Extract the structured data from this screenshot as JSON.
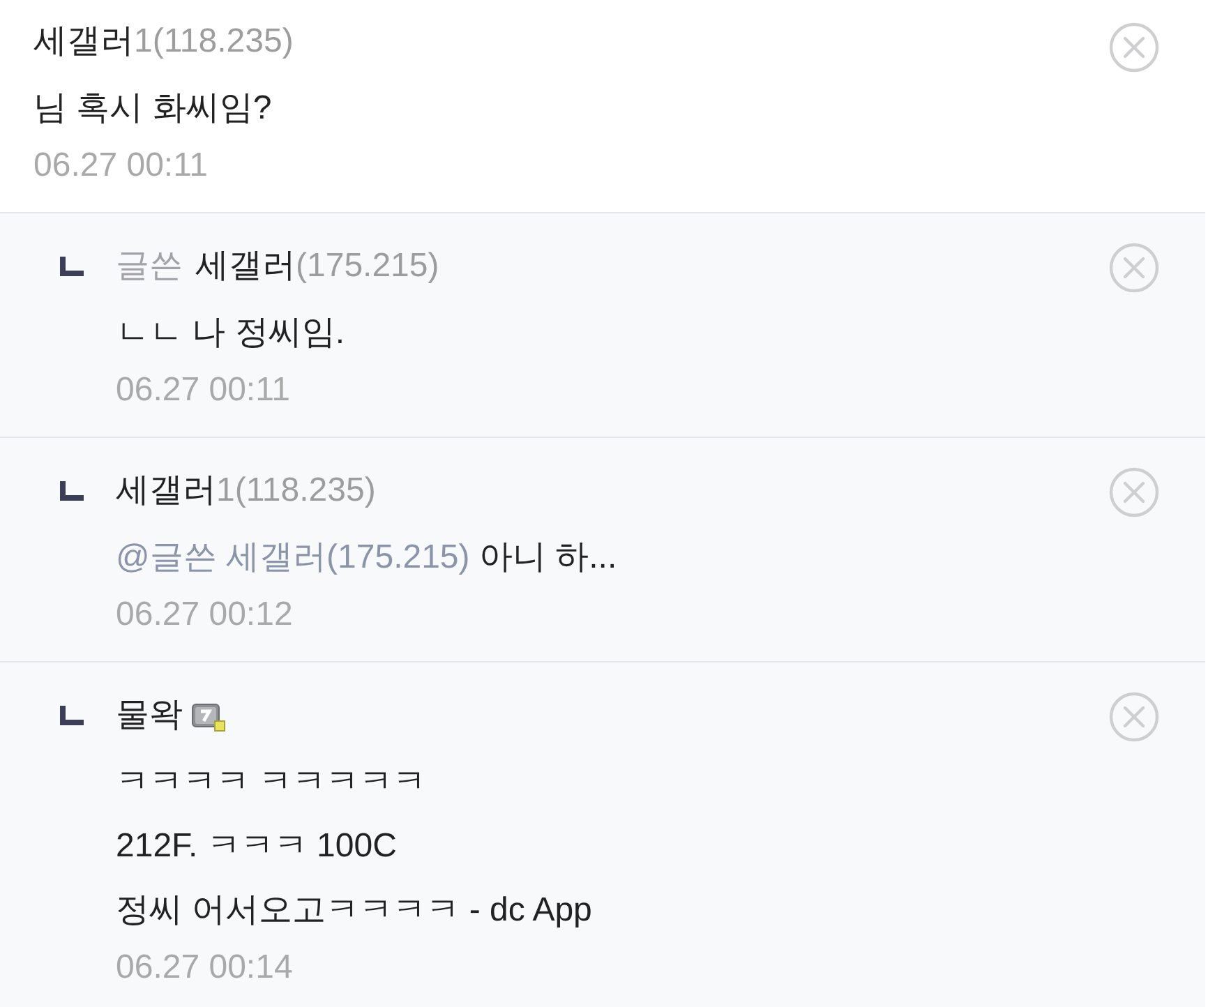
{
  "comments": [
    {
      "kind": "comment",
      "author": "세갤러",
      "ip": "1(118.235)",
      "member_badge": false,
      "lines": [
        "님 혹시 화씨임?"
      ],
      "date": "06.27 00:11"
    },
    {
      "kind": "reply",
      "writer_badge": "글쓴",
      "author": "세갤러",
      "ip": "(175.215)",
      "member_badge": false,
      "lines": [
        "ㄴㄴ 나 정씨임."
      ],
      "date": "06.27 00:11"
    },
    {
      "kind": "reply",
      "author": "세갤러",
      "ip": "1(118.235)",
      "member_badge": false,
      "mention": "@글쓴 세갤러(175.215)",
      "lines": [
        "아니 하..."
      ],
      "date": "06.27 00:12"
    },
    {
      "kind": "reply",
      "author": "물왁",
      "member_badge": true,
      "lines": [
        "ㅋㅋㅋㅋ ㅋㅋㅋㅋㅋ",
        "212F. ㅋㅋㅋ 100C",
        "정씨 어서오고ㅋㅋㅋㅋ - dc App"
      ],
      "date": "06.27 00:14"
    }
  ]
}
